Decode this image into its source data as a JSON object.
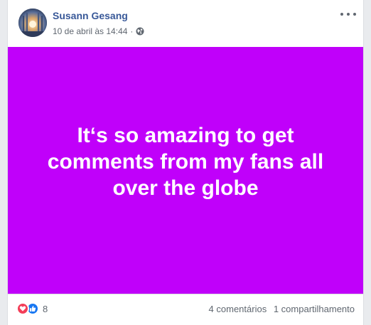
{
  "post": {
    "author": "Susann Gesang",
    "timestamp": "10 de abril às 14:44",
    "separator": "·",
    "privacy_icon": "globe-icon",
    "text": "It‘s so amazing to get comments from my fans all over the globe",
    "background_color": "#c000fa"
  },
  "footer": {
    "reaction_icons": [
      "love-icon",
      "like-icon"
    ],
    "reaction_count": "8",
    "comments": "4 comentários",
    "shares": "1 compartilhamento"
  },
  "colors": {
    "author_link": "#385898",
    "love": "#f33e58",
    "like": "#1877f2"
  }
}
